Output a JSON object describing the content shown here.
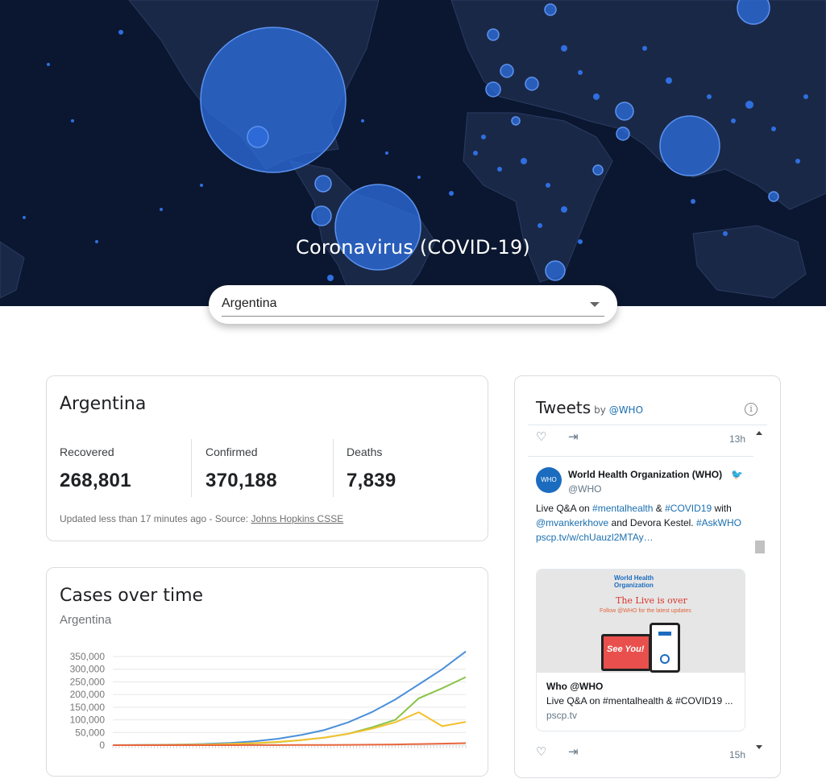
{
  "hero": {
    "title": "Coronavirus (COVID-19)",
    "background_color": "#0b1730",
    "land_color": "#1c2b4a",
    "bubble_color": "#2f6fe0"
  },
  "country_select": {
    "value": "Argentina"
  },
  "stats_card": {
    "title": "Argentina",
    "recovered_label": "Recovered",
    "recovered_value": "268,801",
    "confirmed_label": "Confirmed",
    "confirmed_value": "370,188",
    "deaths_label": "Deaths",
    "deaths_value": "7,839",
    "updated_text": "Updated less than 17 minutes ago - Source: ",
    "source_link": "Johns Hopkins CSSE"
  },
  "chart_card": {
    "title": "Cases over time",
    "subtitle": "Argentina"
  },
  "chart_data": {
    "type": "line",
    "ytick_labels": [
      "350,000",
      "300,000",
      "250,000",
      "200,000",
      "150,000",
      "100,000",
      "50,000",
      "0"
    ],
    "ylim": [
      0,
      350000
    ],
    "grid": true,
    "series": [
      {
        "color": "#4a90d9",
        "values": [
          0,
          500,
          1500,
          3000,
          5000,
          9000,
          15000,
          25000,
          40000,
          60000,
          90000,
          130000,
          180000,
          240000,
          300000,
          370188
        ]
      },
      {
        "color": "#8bc34a",
        "values": [
          0,
          100,
          400,
          1000,
          2000,
          4000,
          7000,
          12000,
          20000,
          30000,
          45000,
          70000,
          100000,
          185000,
          225000,
          268801
        ]
      },
      {
        "color": "#f2c12e",
        "values": [
          0,
          300,
          1000,
          2000,
          3000,
          5000,
          8000,
          13000,
          20000,
          30000,
          45000,
          65000,
          90000,
          130000,
          75000,
          92000
        ]
      },
      {
        "color": "#e8663d",
        "values": [
          0,
          10,
          30,
          60,
          100,
          150,
          250,
          400,
          600,
          900,
          1300,
          2000,
          3000,
          4500,
          6000,
          7839
        ]
      }
    ]
  },
  "tweets": {
    "title": "Tweets",
    "by": "by",
    "by_handle": "@WHO",
    "time_top": "13h",
    "author_name": "World Health Organization (WHO)",
    "author_handle": "@WHO",
    "text_1": "Live Q&A on ",
    "tag_1": "#mentalhealth",
    "text_2": " & ",
    "tag_2": "#COVID19",
    "text_3": " with",
    "mention_1": "@mvankerkhove",
    "text_4": " and Devora Kestel. ",
    "tag_3": "#AskWHO",
    "link_1": "pscp.tv/w/chUauzl2MTAy…",
    "media_org": "World Health Organization",
    "media_headline": "The Live is over",
    "media_sub": "Follow @WHO for the latest updates",
    "media_see": "See You!",
    "media_title": "Who @WHO",
    "media_desc": "Live Q&A on #mentalhealth & #COVID19 ...",
    "media_url": "pscp.tv",
    "time_bottom": "15h"
  }
}
